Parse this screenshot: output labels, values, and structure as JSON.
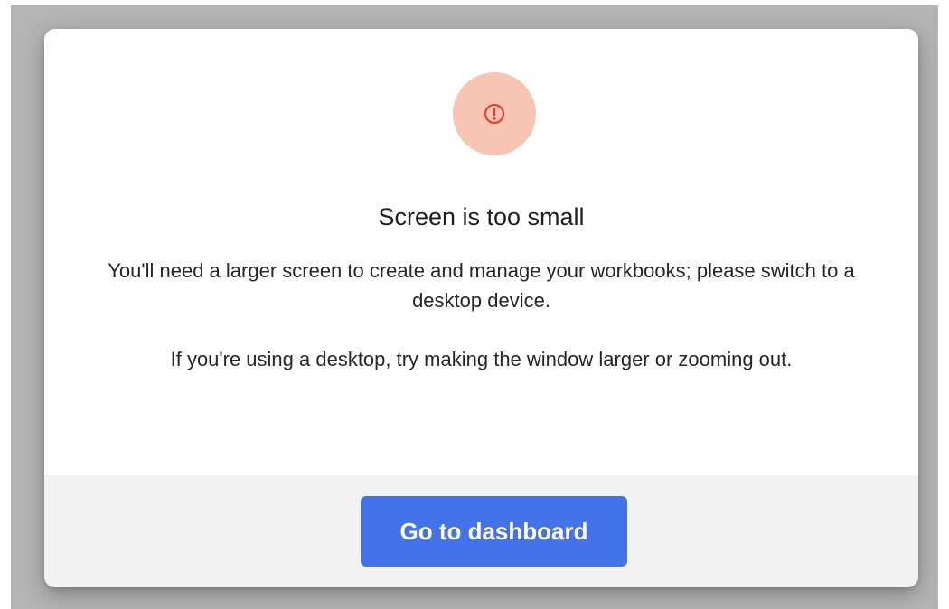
{
  "dialog": {
    "icon": "alert-circle-icon",
    "title": "Screen is too small",
    "message_1": "You'll need a larger screen to create and manage your workbooks; please switch to a desktop device.",
    "message_2": "If you're using a desktop, try making the window larger or zooming out.",
    "primary_button_label": "Go to dashboard"
  },
  "colors": {
    "backdrop": "#b4b4b4",
    "icon_bg": "#f8c4b4",
    "icon_fg": "#e0442a",
    "footer_bg": "#f2f2f2",
    "primary_button_bg": "#4472e8"
  }
}
